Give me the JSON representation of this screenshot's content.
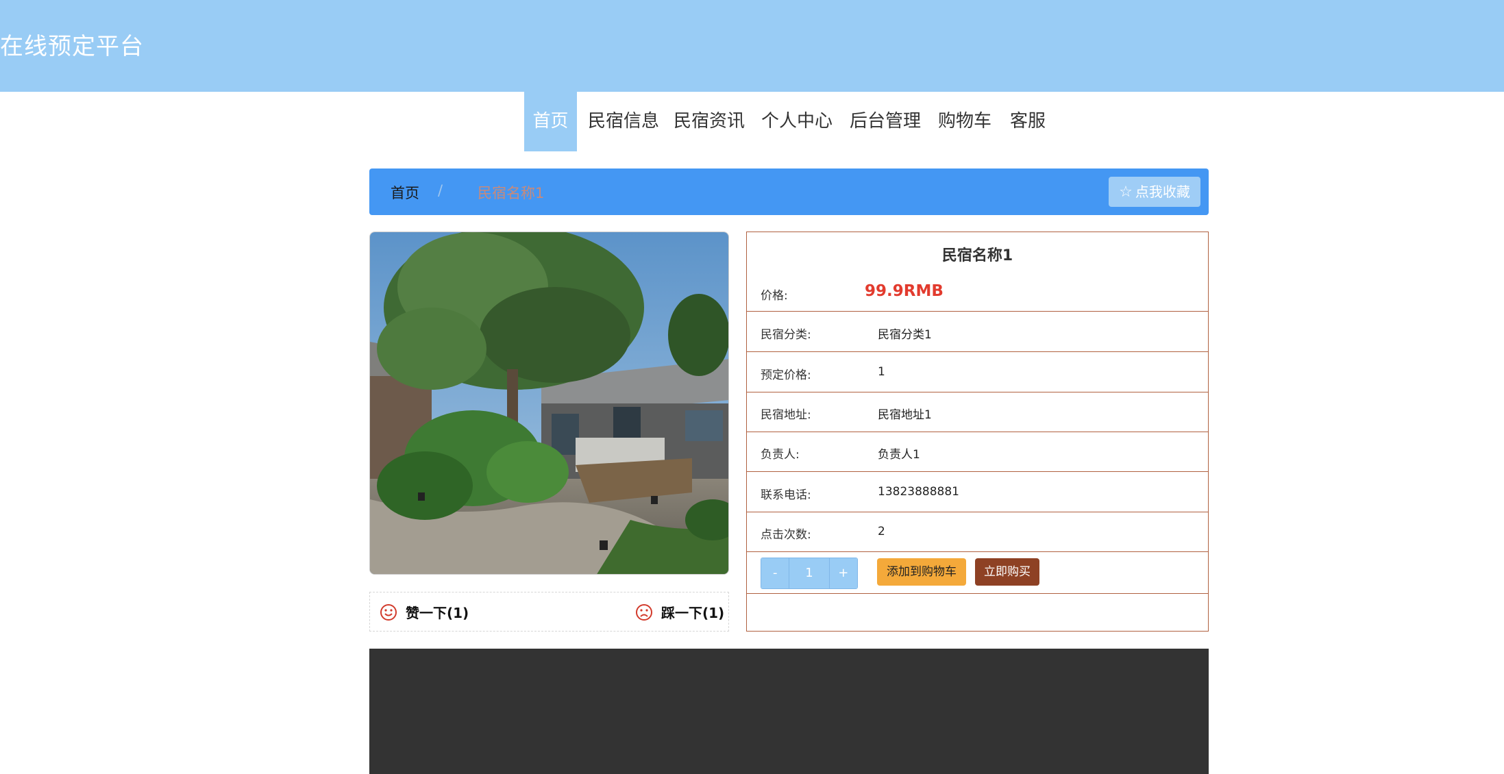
{
  "header": {
    "brand": "在线预定平台"
  },
  "nav": {
    "items": [
      {
        "label": "首页",
        "active": true
      },
      {
        "label": "民宿信息",
        "active": false
      },
      {
        "label": "民宿资讯",
        "active": false
      },
      {
        "label": "个人中心",
        "active": false
      },
      {
        "label": "后台管理",
        "active": false
      },
      {
        "label": "购物车",
        "active": false
      },
      {
        "label": "客服",
        "active": false
      }
    ]
  },
  "breadcrumb": {
    "home": "首页",
    "separator": "/",
    "current": "民宿名称1"
  },
  "favorite": {
    "icon": "star-outline-icon",
    "label": "点我收藏"
  },
  "votes": {
    "like_label": "赞一下(1)",
    "dislike_label": "踩一下(1)"
  },
  "detail": {
    "title": "民宿名称1",
    "price_label": "价格:",
    "price_value": "99.9RMB",
    "fields": [
      {
        "label": "民宿分类:",
        "value": "民宿分类1"
      },
      {
        "label": "预定价格:",
        "value": "1"
      },
      {
        "label": "民宿地址:",
        "value": "民宿地址1"
      },
      {
        "label": "负责人:",
        "value": "负责人1"
      },
      {
        "label": "联系电话:",
        "value": "13823888881"
      },
      {
        "label": "点击次数:",
        "value": "2"
      }
    ],
    "quantity": {
      "minus": "-",
      "value": "1",
      "plus": "+"
    },
    "add_to_cart": "添加到购物车",
    "buy_now": "立即购买"
  },
  "colors": {
    "header_bg": "#99ccf5",
    "breadcrumb_bg": "#4497f3",
    "price": "#e23b2e",
    "cart_button": "#f4a93a",
    "buy_button": "#8e4124",
    "footer_bg": "#333333"
  }
}
